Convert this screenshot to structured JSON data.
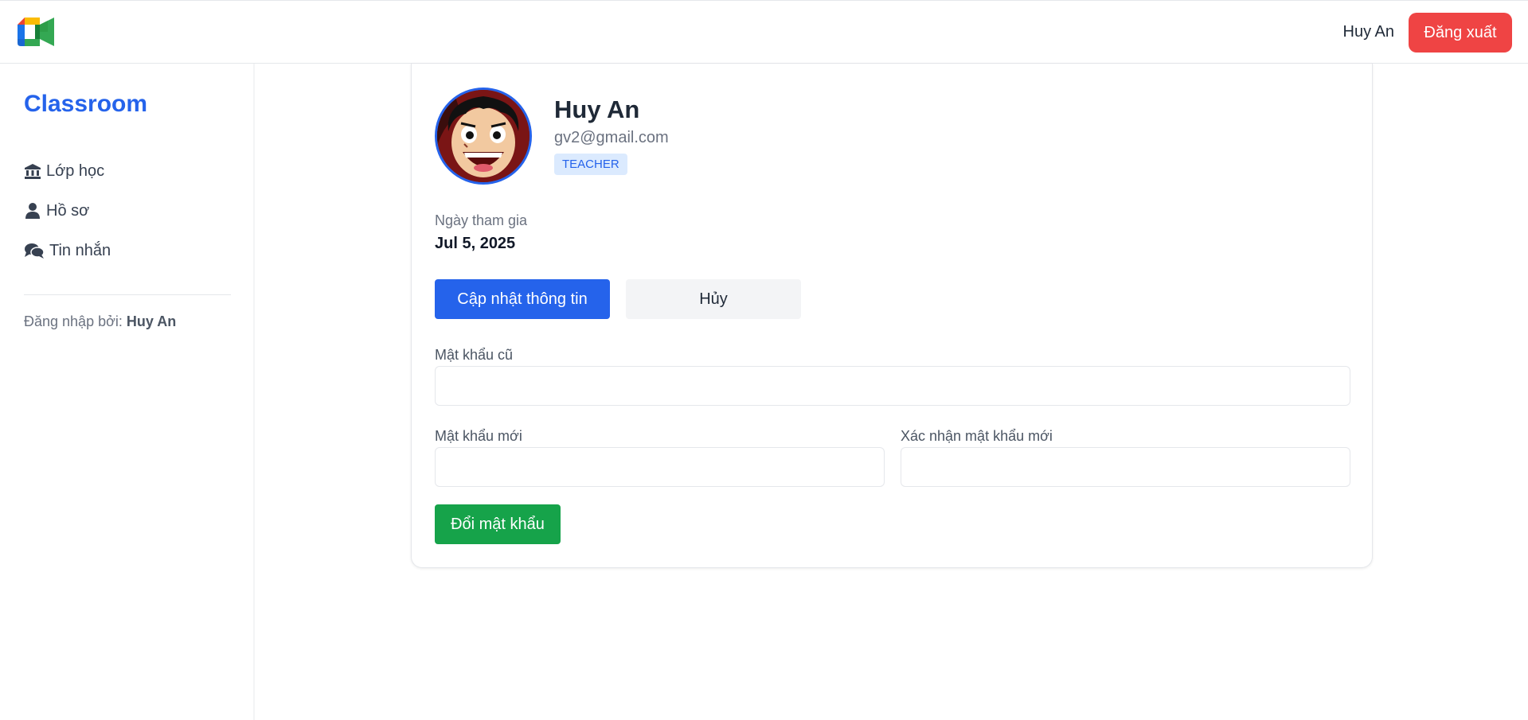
{
  "header": {
    "logo_icon": "video-meet-logo-icon",
    "user_name": "Huy An",
    "logout_label": "Đăng xuất"
  },
  "sidebar": {
    "brand": "Classroom",
    "items": [
      {
        "icon": "classroom-building-icon",
        "label": "Lớp học"
      },
      {
        "icon": "user-icon",
        "label": "Hồ sơ"
      },
      {
        "icon": "chat-bubbles-icon",
        "label": "Tin nhắn"
      }
    ],
    "login_by_prefix": "Đăng nhập bởi:",
    "login_by_name": "Huy An"
  },
  "profile": {
    "name": "Huy An",
    "email": "gv2@gmail.com",
    "role": "TEACHER",
    "join_label": "Ngày tham gia",
    "join_date": "Jul 5, 2025",
    "update_label": "Cập nhật thông tin",
    "cancel_label": "Hủy"
  },
  "password_form": {
    "old_label": "Mật khẩu cũ",
    "old_value": "",
    "new_label": "Mật khẩu mới",
    "new_value": "",
    "confirm_label": "Xác nhận mật khẩu mới",
    "confirm_value": "",
    "submit_label": "Đổi mật khẩu"
  },
  "colors": {
    "primary": "#2563eb",
    "danger": "#ef4444",
    "success": "#16a34a"
  }
}
